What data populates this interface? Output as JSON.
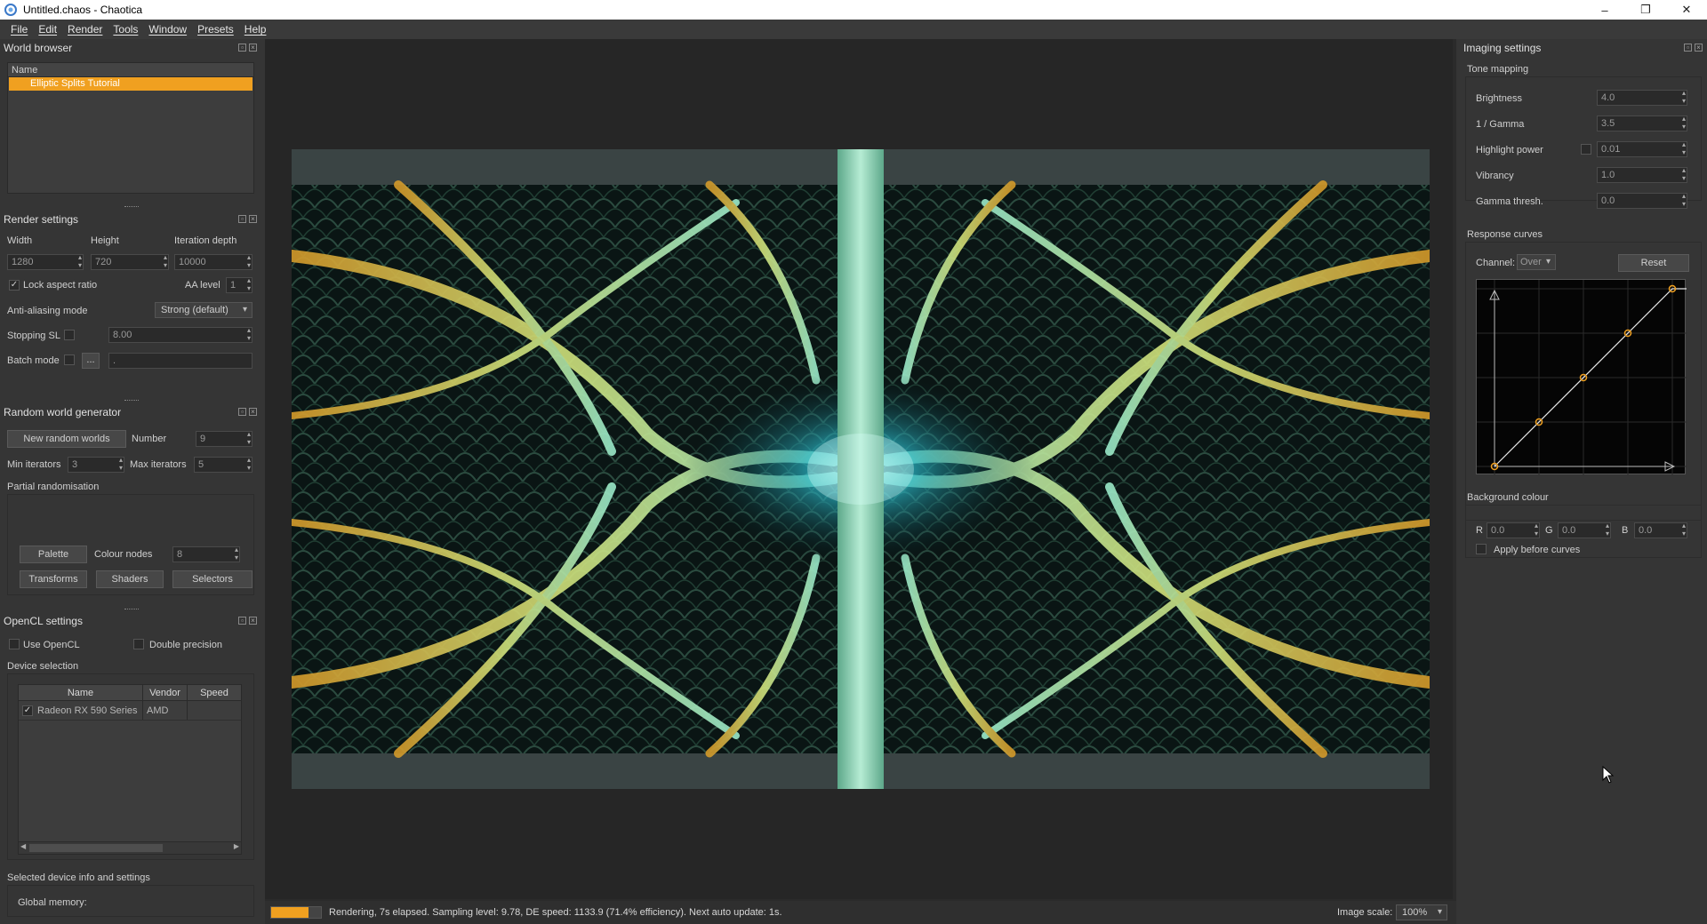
{
  "window": {
    "title": "Untitled.chaos - Chaotica",
    "controls": [
      "–",
      "❐",
      "✕"
    ]
  },
  "menu": [
    "File",
    "Edit",
    "Render",
    "Tools",
    "Window",
    "Presets",
    "Help"
  ],
  "world_browser": {
    "title": "World browser",
    "column": "Name",
    "items": [
      "Elliptic Splits Tutorial"
    ]
  },
  "render_settings": {
    "title": "Render settings",
    "width_label": "Width",
    "height_label": "Height",
    "depth_label": "Iteration depth",
    "width": "1280",
    "height": "720",
    "depth": "10000",
    "lock_aspect_label": "Lock aspect ratio",
    "aa_level_label": "AA level",
    "aa_level": "1",
    "aa_mode_label": "Anti-aliasing mode",
    "aa_mode": "Strong (default)",
    "stopping_sl_label": "Stopping SL",
    "stopping_sl": "8.00",
    "batch_mode_label": "Batch mode",
    "batch_button": "...",
    "batch_value": "."
  },
  "random_world": {
    "title": "Random world generator",
    "new_button": "New random worlds",
    "number_label": "Number",
    "number": "9",
    "min_iter_label": "Min iterators",
    "min_iter": "3",
    "max_iter_label": "Max iterators",
    "max_iter": "5",
    "partial_label": "Partial randomisation",
    "palette_button": "Palette",
    "colour_nodes_label": "Colour nodes",
    "colour_nodes": "8",
    "transforms_button": "Transforms",
    "shaders_button": "Shaders",
    "selectors_button": "Selectors"
  },
  "opencl": {
    "title": "OpenCL settings",
    "use_opencl_label": "Use OpenCL",
    "double_precision_label": "Double precision",
    "device_selection_label": "Device selection",
    "columns": [
      "Name",
      "Vendor",
      "Speed"
    ],
    "devices": [
      {
        "name": "Radeon RX 590 Series",
        "vendor": "AMD",
        "speed": ""
      }
    ],
    "selected_info_label": "Selected device info and settings",
    "global_memory_label": "Global memory:"
  },
  "status": {
    "message": "Rendering, 7s elapsed. Sampling level: 9.78, DE speed: 1133.9 (71.4% efficiency). Next auto update: 1s.",
    "progress": 0.75,
    "image_scale_label": "Image scale:",
    "image_scale": "100%"
  },
  "imaging": {
    "title": "Imaging settings",
    "tone_mapping_label": "Tone mapping",
    "brightness_label": "Brightness",
    "brightness": "4.0",
    "gamma_label": "1 / Gamma",
    "gamma": "3.5",
    "highlight_label": "Highlight power",
    "highlight": "0.01",
    "vibrancy_label": "Vibrancy",
    "vibrancy": "1.0",
    "gamma_thresh_label": "Gamma thresh.",
    "gamma_thresh": "0.0",
    "response_label": "Response curves",
    "channel_label": "Channel:",
    "channel": "Over",
    "reset_button": "Reset",
    "background_label": "Background colour",
    "r_label": "R",
    "r": "0.0",
    "g_label": "G",
    "g": "0.0",
    "b_label": "B",
    "b": "0.0",
    "apply_before_label": "Apply before curves"
  },
  "colors": {
    "accent": "#f0a020",
    "panel": "#353535",
    "viewport": "#262626"
  }
}
